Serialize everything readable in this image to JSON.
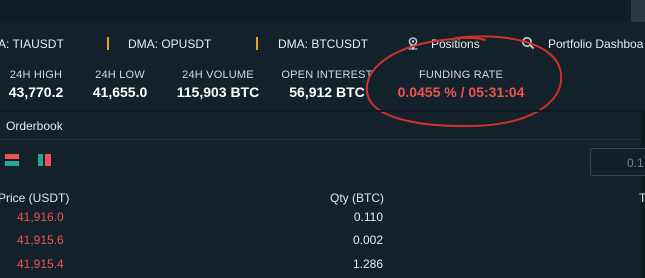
{
  "ticker_bar": {
    "items": [
      {
        "label": "A: TIAUSDT"
      },
      {
        "label": "DMA: OPUSDT"
      },
      {
        "label": "DMA: BTCUSDT"
      }
    ],
    "positions_label": "Positions",
    "portfolio_label": "Portfolio Dashboa"
  },
  "stats": {
    "high_label": "24H HIGH",
    "high_value": "43,770.2",
    "low_label": "24H LOW",
    "low_value": "41,655.0",
    "volume_label": "24H VOLUME",
    "volume_value": "115,903 BTC",
    "oi_label": "OPEN INTEREST",
    "oi_value": "56,912 BTC",
    "funding_label": "FUNDING RATE",
    "funding_value": "0.0455 % / 05:31:04"
  },
  "orderbook": {
    "title": "Orderbook",
    "precision": "0.1",
    "columns": {
      "price": "Price (USDT)",
      "qty": "Qty (BTC)",
      "total": "T"
    },
    "rows": [
      {
        "price": "41,916.0",
        "qty": "0.110"
      },
      {
        "price": "41,915.6",
        "qty": "0.002"
      },
      {
        "price": "41,915.4",
        "qty": "1.286"
      }
    ]
  },
  "colors": {
    "background": "#12212a",
    "ask_red": "#ef5350",
    "separator_orange": "#f0a020",
    "annotation_red": "#d0302a"
  },
  "icons": {
    "positions": "location-pin-icon",
    "portfolio": "search-icon",
    "layout_both": "orderbook-both-icon",
    "layout_split": "orderbook-split-icon"
  }
}
